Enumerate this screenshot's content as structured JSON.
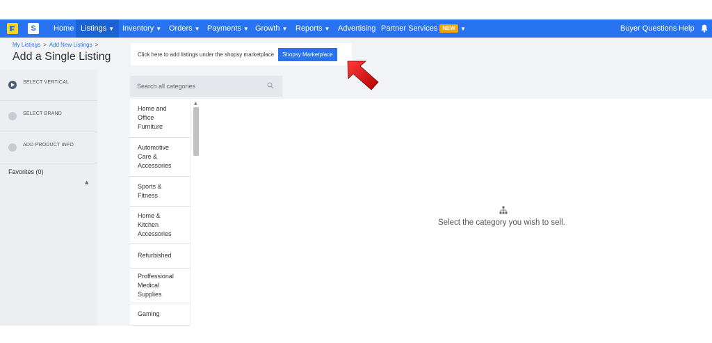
{
  "navbar": {
    "logo_shopsy": "S",
    "items": [
      {
        "label": "Home",
        "caret": false
      },
      {
        "label": "Listings",
        "caret": true,
        "active": true
      },
      {
        "label": "Inventory",
        "caret": true
      },
      {
        "label": "Orders",
        "caret": true
      },
      {
        "label": "Payments",
        "caret": true
      },
      {
        "label": "Growth",
        "caret": true
      },
      {
        "label": "Reports",
        "caret": true
      },
      {
        "label": "Advertising",
        "caret": false
      },
      {
        "label": "Partner Services",
        "caret": true,
        "badge": "NEW"
      }
    ],
    "right_items": [
      "Buyer Questions",
      "Help"
    ],
    "caret_glyph": "▼",
    "colors": {
      "bar": "#2874f0",
      "active": "#1d62d2",
      "badge": "#f7a400"
    }
  },
  "breadcrumb": {
    "items": [
      "My Listings",
      "Add New Listings"
    ],
    "separator": ">"
  },
  "page_title": "Add a Single Listing",
  "notice": {
    "text": "Click here to add listings under the shopsy marketplace",
    "button_label": "Shopsy Marketplace"
  },
  "sidebar": {
    "steps": [
      {
        "label": "SELECT VERTICAL",
        "active": true
      },
      {
        "label": "SELECT BRAND",
        "active": false
      },
      {
        "label": "ADD PRODUCT INFO",
        "active": false
      }
    ],
    "favorites_label": "Favorites (0)",
    "caret_glyph": "▲"
  },
  "search": {
    "placeholder": "Search all categories"
  },
  "categories": [
    {
      "label": "Home and\nOffice\nFurniture"
    },
    {
      "label": "Automotive\nCare &\nAccessories"
    },
    {
      "label": "Sports &\nFitness"
    },
    {
      "label": "Home &\nKitchen\nAccessories"
    },
    {
      "label": "Refurbished"
    },
    {
      "label": "Proffessional\nMedical\nSupplies"
    },
    {
      "label": "Gaming"
    }
  ],
  "scroll_glyph": "▲",
  "empty_state": {
    "message": "Select the category you wish to sell."
  }
}
